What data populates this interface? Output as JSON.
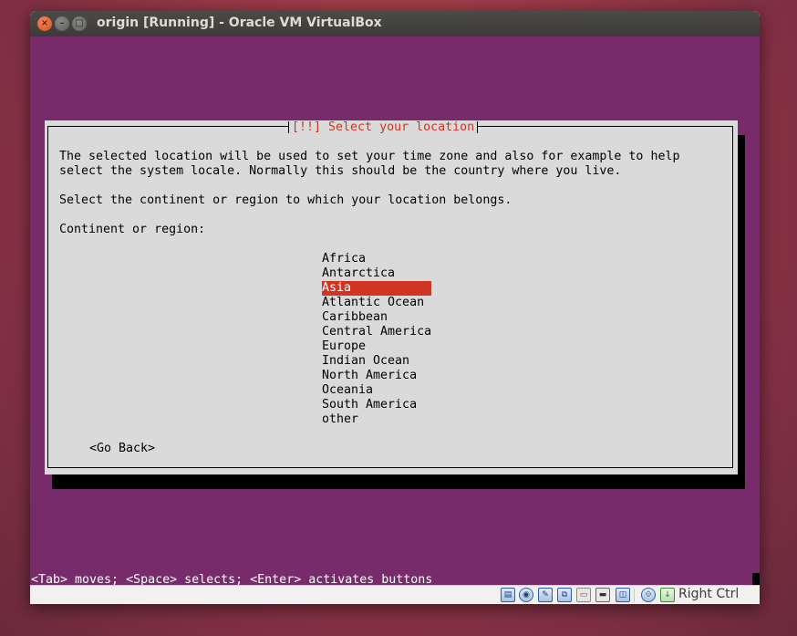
{
  "window": {
    "title": "origin [Running] - Oracle VM VirtualBox",
    "close_glyph": "×",
    "min_glyph": "–",
    "max_glyph": "□"
  },
  "installer": {
    "dialog_title": "[!!] Select your location",
    "description_line1": "The selected location will be used to set your time zone and also for example to help",
    "description_line2": "select the system locale. Normally this should be the country where you live.",
    "prompt": "Select the continent or region to which your location belongs.",
    "list_label": "Continent or region:",
    "options": [
      "Africa",
      "Antarctica",
      "Asia",
      "Atlantic Ocean",
      "Caribbean",
      "Central America",
      "Europe",
      "Indian Ocean",
      "North America",
      "Oceania",
      "South America",
      "other"
    ],
    "selected_option": "Asia",
    "go_back_label": "<Go Back>",
    "key_hint": "<Tab> moves; <Space> selects; <Enter> activates buttons"
  },
  "statusbar": {
    "host_key": "Right Ctrl",
    "icons": [
      "hard-disk-icon",
      "optical-drive-icon",
      "usb-icon",
      "network-icon",
      "shared-folders-icon",
      "display-icon",
      "video-capture-icon",
      "virtualization-icon",
      "mouse-integration-icon"
    ]
  },
  "colors": {
    "vm_background": "#772b6a",
    "dialog_background": "#dadada",
    "highlight": "#d03524",
    "desktop": "#8e3446"
  }
}
